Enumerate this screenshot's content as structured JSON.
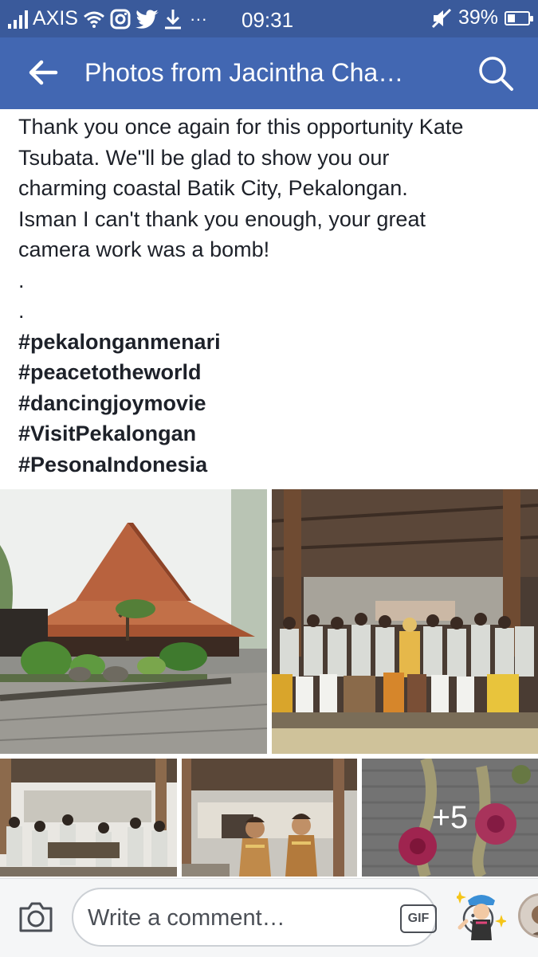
{
  "status_bar": {
    "carrier": "AXIS",
    "time": "09:31",
    "battery": "39%",
    "icons": [
      "signal-icon",
      "wifi-icon",
      "instagram-icon",
      "twitter-icon",
      "download-icon",
      "more-dots-icon",
      "mute-icon",
      "battery-icon"
    ],
    "overflow_dots": "···"
  },
  "app_bar": {
    "title": "Photos from Jacintha Cha…",
    "back_icon": "back-arrow-icon",
    "search_icon": "search-icon"
  },
  "post": {
    "lines": [
      "Thank you once again for this opportunity Kate",
      "Tsubata. We\"ll be glad to show you our",
      "charming coastal Batik City, Pekalongan.",
      "Isman I can't thank you enough, your great",
      "camera work was a bomb!"
    ],
    "dot1": ".",
    "dot2": ".",
    "hashtags": [
      "#pekalonganmenari",
      "#peacetotheworld",
      "#dancingjoymovie",
      "#VisitPekalongan",
      "#PesonaIndonesia"
    ]
  },
  "photos": {
    "more_count": "+5"
  },
  "comment_bar": {
    "placeholder": "Write a comment…",
    "gif_label": "GIF",
    "camera_icon": "camera-icon",
    "smiley_icon": "smiley-icon",
    "sticker_icon": "sticker-icon"
  },
  "colors": {
    "status_bar": "#3a5a9b",
    "app_bar": "#4267b2",
    "text": "#1d2129"
  }
}
